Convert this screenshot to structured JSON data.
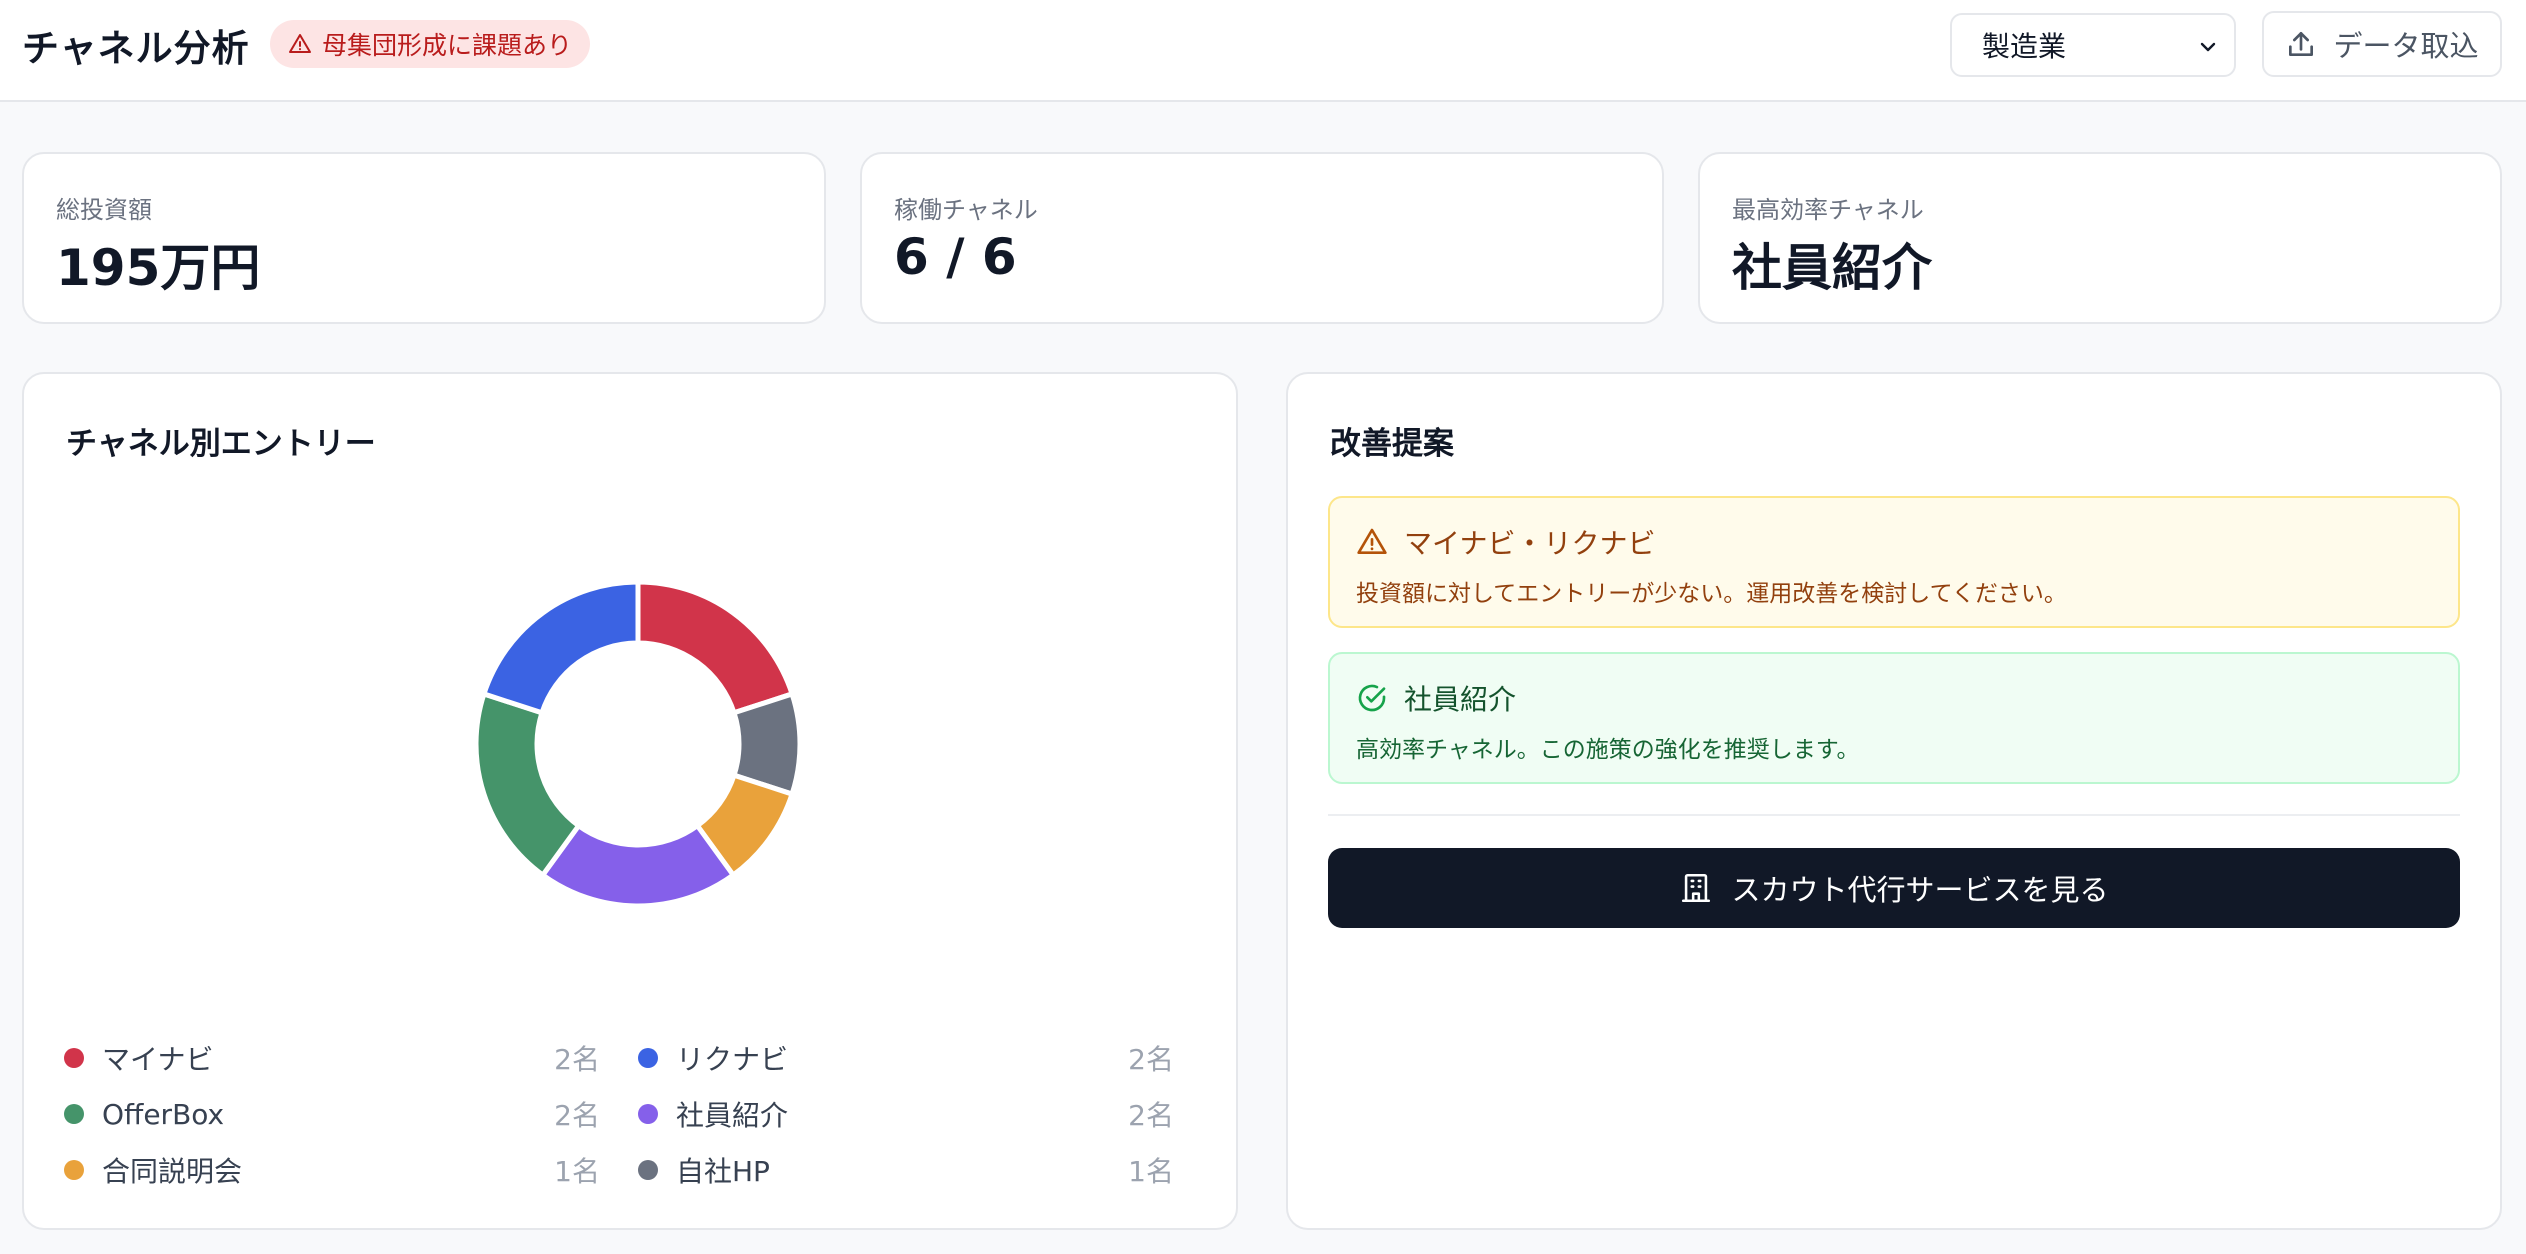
{
  "header": {
    "title": "チャネル分析",
    "warning_badge": "母集団形成に課題あり",
    "industry_select": "製造業",
    "import_button": "データ取込"
  },
  "kpis": [
    {
      "label": "総投資額",
      "value": "195万円"
    },
    {
      "label": "稼働チャネル",
      "value": "6 / 6"
    },
    {
      "label": "最高効率チャネル",
      "value": "社員紹介"
    }
  ],
  "channel_panel": {
    "title": "チャネル別エントリー",
    "legend": [
      {
        "name": "マイナビ",
        "count": "2名",
        "color": "#d1344a"
      },
      {
        "name": "リクナビ",
        "count": "2名",
        "color": "#3b63e3"
      },
      {
        "name": "OfferBox",
        "count": "2名",
        "color": "#45946a"
      },
      {
        "name": "社員紹介",
        "count": "2名",
        "color": "#8560ea"
      },
      {
        "name": "合同説明会",
        "count": "1名",
        "color": "#e9a23b"
      },
      {
        "name": "自社HP",
        "count": "1名",
        "color": "#6b7280"
      }
    ]
  },
  "chart_data": {
    "type": "pie",
    "donut": true,
    "categories": [
      "マイナビ",
      "自社HP",
      "合同説明会",
      "社員紹介",
      "OfferBox",
      "リクナビ"
    ],
    "values": [
      2,
      1,
      1,
      2,
      2,
      2
    ],
    "colors": [
      "#d1344a",
      "#6b7280",
      "#e9a23b",
      "#8560ea",
      "#45946a",
      "#3b63e3"
    ],
    "unit": "名"
  },
  "suggestions": {
    "title": "改善提案",
    "warning": {
      "title": "マイナビ・リクナビ",
      "body": "投資額に対してエントリーが少ない。運用改善を検討してください。"
    },
    "success": {
      "title": "社員紹介",
      "body": "高効率チャネル。この施策の強化を推奨します。"
    },
    "cta": "スカウト代行サービスを見る"
  }
}
